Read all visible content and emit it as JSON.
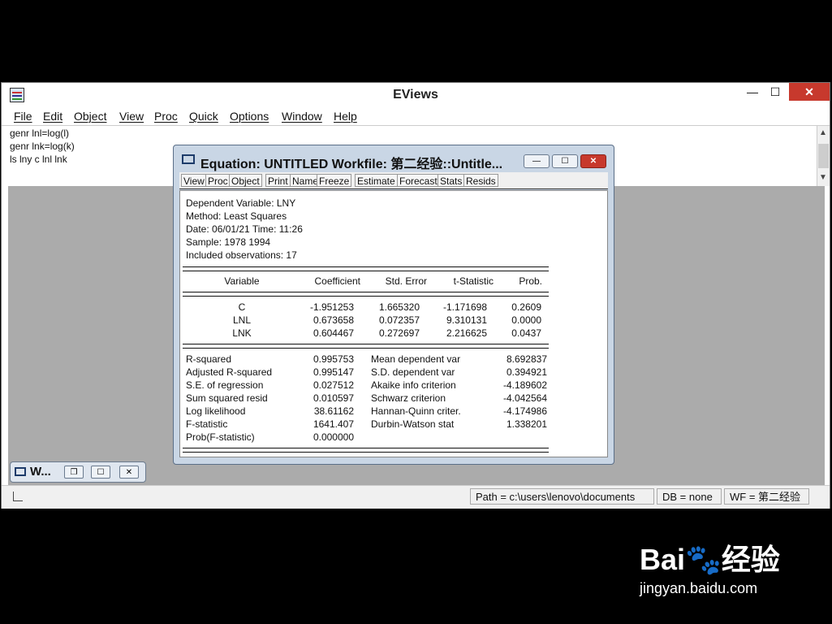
{
  "app": {
    "title": "EViews",
    "window_buttons": {
      "minimize": "—",
      "maximize": "☐",
      "close": "✕"
    }
  },
  "menu": [
    "File",
    "Edit",
    "Object",
    "View",
    "Proc",
    "Quick",
    "Options",
    "Window",
    "Help"
  ],
  "command_pane": {
    "lines": [
      "genr lnl=log(l)",
      "genr lnk=log(k)",
      "ls lny c lnl lnk"
    ]
  },
  "minimized_window": {
    "title": "W..."
  },
  "status_bar": {
    "path": "Path = c:\\users\\lenovo\\documents",
    "db": "DB = none",
    "wf": "WF = 第二经验"
  },
  "equation_window": {
    "title": "Equation: UNTITLED   Workfile: 第二经验::Untitle...",
    "toolbar": [
      "View",
      "Proc",
      "Object",
      "Print",
      "Name",
      "Freeze",
      "Estimate",
      "Forecast",
      "Stats",
      "Resids"
    ],
    "header": [
      "Dependent Variable: LNY",
      "Method: Least Squares",
      "Date: 06/01/21   Time: 11:26",
      "Sample: 1978 1994",
      "Included observations: 17"
    ],
    "columns": [
      "Variable",
      "Coefficient",
      "Std. Error",
      "t-Statistic",
      "Prob."
    ],
    "rows": [
      [
        "C",
        "-1.951253",
        "1.665320",
        "-1.171698",
        "0.2609"
      ],
      [
        "LNL",
        "0.673658",
        "0.072357",
        "9.310131",
        "0.0000"
      ],
      [
        "LNK",
        "0.604467",
        "0.272697",
        "2.216625",
        "0.0437"
      ]
    ],
    "stats_left": [
      [
        "R-squared",
        "0.995753"
      ],
      [
        "Adjusted R-squared",
        "0.995147"
      ],
      [
        "S.E. of regression",
        "0.027512"
      ],
      [
        "Sum squared resid",
        "0.010597"
      ],
      [
        "Log likelihood",
        "38.61162"
      ],
      [
        "F-statistic",
        "1641.407"
      ],
      [
        "Prob(F-statistic)",
        "0.000000"
      ]
    ],
    "stats_right": [
      [
        "Mean dependent var",
        "8.692837"
      ],
      [
        "S.D. dependent var",
        "0.394921"
      ],
      [
        "Akaike info criterion",
        "-4.189602"
      ],
      [
        "Schwarz criterion",
        "-4.042564"
      ],
      [
        "Hannan-Quinn criter.",
        "-4.174986"
      ],
      [
        "Durbin-Watson stat",
        "1.338201"
      ]
    ]
  },
  "watermark": {
    "logo": "Bai🐾经验",
    "url": "jingyan.baidu.com"
  }
}
